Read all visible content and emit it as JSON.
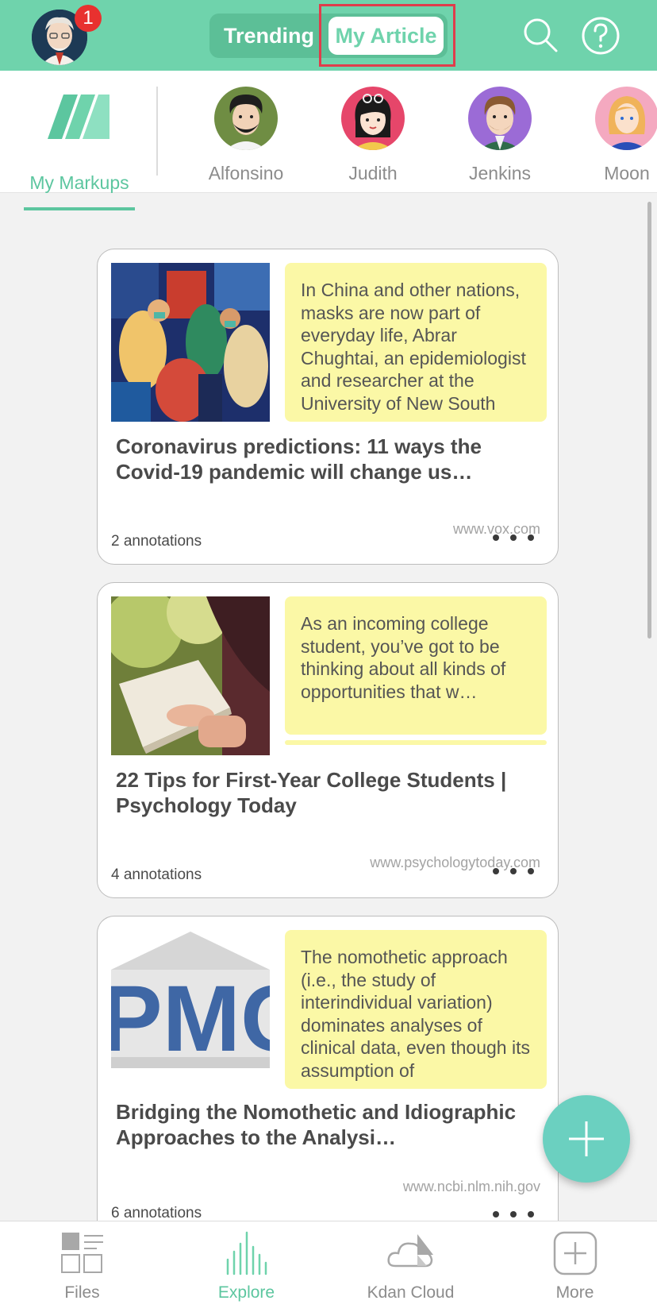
{
  "header": {
    "notification_count": "1",
    "tabs": {
      "trending": "Trending",
      "my_article": "My Article"
    },
    "accent_color": "#6fd3ac",
    "highlight_color": "#e03d4b"
  },
  "friends": {
    "my_markups_label": "My Markups",
    "people": [
      {
        "name": "Alfonsino"
      },
      {
        "name": "Judith"
      },
      {
        "name": "Jenkins"
      },
      {
        "name": "Moon"
      }
    ]
  },
  "articles": [
    {
      "quote": "In China and other nations, masks are now part of everyday life, Abrar Chughtai, an epidemiologist and researcher at the University of New South",
      "title": "Coronavirus predictions: 11 ways the Covid-19 pandemic will change us…",
      "annotations": "2 annotations",
      "domain": "www.vox.com"
    },
    {
      "quote": "As an incoming college student, you’ve got to be thinking about all kinds of opportunities that w…",
      "title": "22 Tips for First-Year College Students | Psychology Today",
      "annotations": "4 annotations",
      "domain": "www.psychologytoday.com"
    },
    {
      "quote": "The nomothetic approach (i.e., the study of interindividual variation) dominates analyses of clinical data, even though its assumption of",
      "title": "Bridging the Nomothetic and Idiographic Approaches to the Analysi…",
      "annotations": "6 annotations",
      "domain": "www.ncbi.nlm.nih.gov"
    }
  ],
  "tabbar": {
    "files": "Files",
    "explore": "Explore",
    "kdan_cloud": "Kdan Cloud",
    "more": "More",
    "active": "Explore"
  }
}
